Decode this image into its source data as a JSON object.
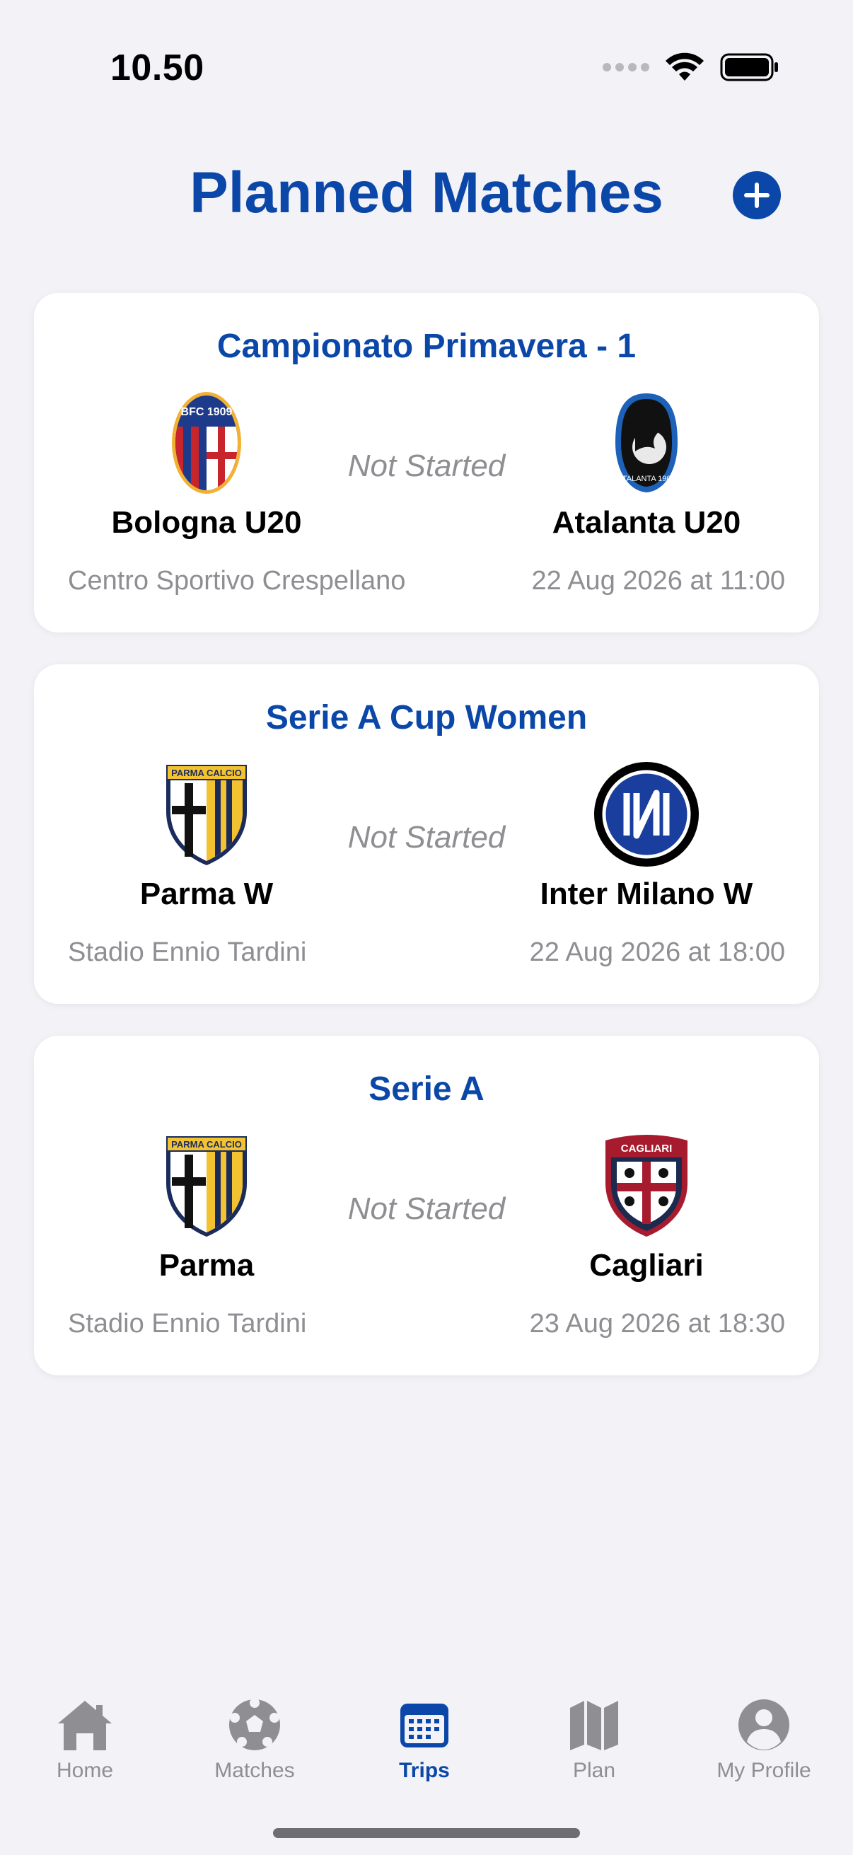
{
  "status_bar": {
    "time": "10.50"
  },
  "header": {
    "title": "Planned Matches",
    "add_icon": "plus-circle-icon"
  },
  "colors": {
    "accent": "#0B47A8",
    "secondary_text": "#8E8E93",
    "background": "#F2F2F7",
    "card": "#FFFFFF"
  },
  "matches": [
    {
      "competition": "Campionato Primavera - 1",
      "status": "Not Started",
      "home_team": "Bologna U20",
      "home_crest": "bologna-crest-icon",
      "away_team": "Atalanta U20",
      "away_crest": "atalanta-crest-icon",
      "venue": "Centro Sportivo Crespellano",
      "datetime": "22 Aug 2026 at 11:00",
      "home_crest_text": "BFC 1909",
      "away_crest_text": "ATALANTA 1907"
    },
    {
      "competition": "Serie A Cup Women",
      "status": "Not Started",
      "home_team": "Parma W",
      "home_crest": "parma-crest-icon",
      "away_team": "Inter Milano W",
      "away_crest": "inter-crest-icon",
      "venue": "Stadio Ennio Tardini",
      "datetime": "22 Aug 2026 at 18:00",
      "home_crest_text": "PARMA CALCIO",
      "away_crest_text": "IM"
    },
    {
      "competition": "Serie A",
      "status": "Not Started",
      "home_team": "Parma",
      "home_crest": "parma-crest-icon",
      "away_team": "Cagliari",
      "away_crest": "cagliari-crest-icon",
      "venue": "Stadio Ennio Tardini",
      "datetime": "23 Aug 2026 at 18:30",
      "home_crest_text": "PARMA CALCIO",
      "away_crest_text": "CAGLIARI"
    }
  ],
  "tab_bar": {
    "active": "Trips",
    "tabs": [
      {
        "label": "Home",
        "icon": "house-icon"
      },
      {
        "label": "Matches",
        "icon": "soccer-ball-icon"
      },
      {
        "label": "Trips",
        "icon": "calendar-icon"
      },
      {
        "label": "Plan",
        "icon": "map-icon"
      },
      {
        "label": "My Profile",
        "icon": "person-circle-icon"
      }
    ]
  }
}
